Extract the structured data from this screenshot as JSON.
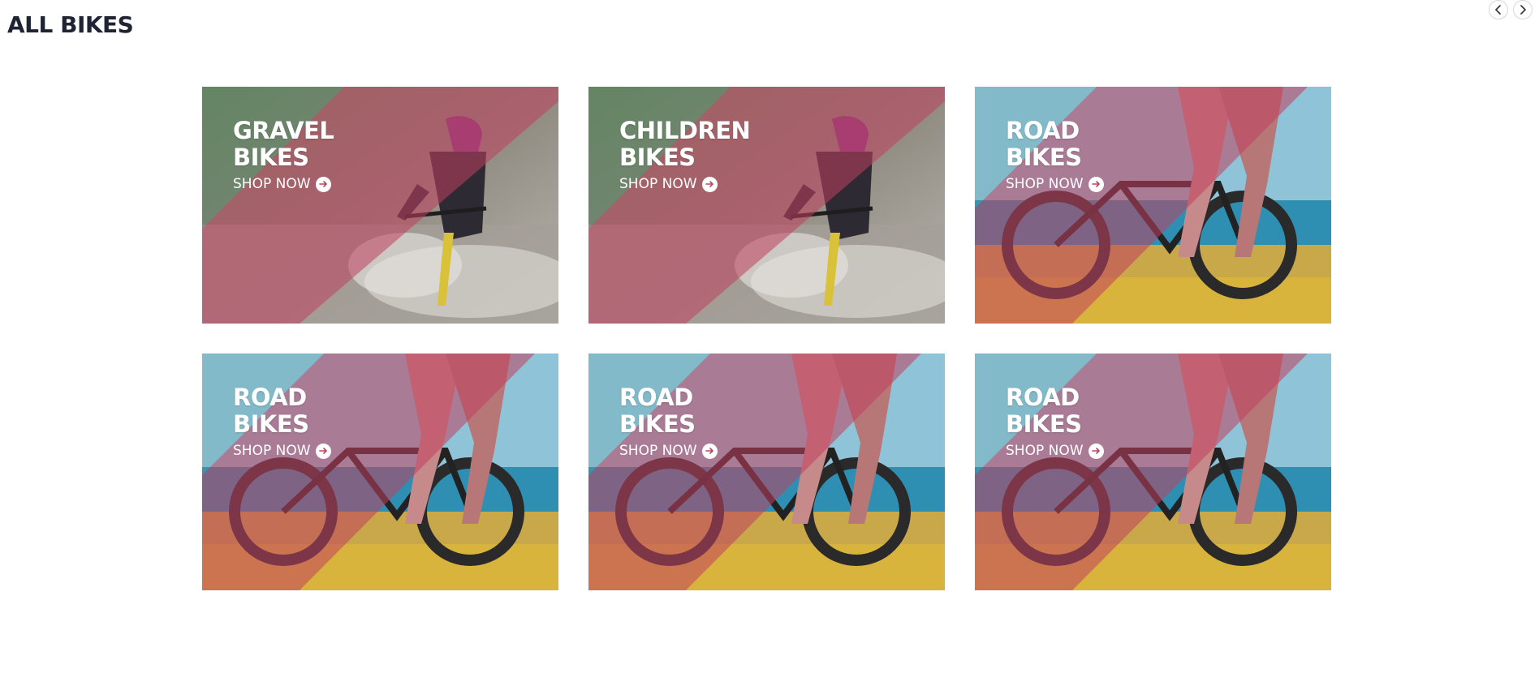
{
  "section": {
    "title": "ALL BIKES"
  },
  "nav": {
    "prev_icon": "chevron-left-icon",
    "next_icon": "chevron-right-icon"
  },
  "colors": {
    "title_text": "#1f2435",
    "overlay_red": "#c0405e",
    "card_text": "#ffffff"
  },
  "cards": [
    {
      "title_line1": "GRAVEL",
      "title_line2": "BIKES",
      "cta": "SHOP NOW",
      "image": "gravel-cyclist-splash",
      "cta_icon": "arrow-right-circle-icon"
    },
    {
      "title_line1": "CHILDREN",
      "title_line2": "BIKES",
      "cta": "SHOP NOW",
      "image": "gravel-cyclist-splash",
      "cta_icon": "arrow-right-circle-icon"
    },
    {
      "title_line1": "ROAD",
      "title_line2": "BIKES",
      "cta": "SHOP NOW",
      "image": "fat-bike-by-sea",
      "cta_icon": "arrow-right-circle-icon"
    },
    {
      "title_line1": "ROAD",
      "title_line2": "BIKES",
      "cta": "SHOP NOW",
      "image": "fat-bike-by-sea",
      "cta_icon": "arrow-right-circle-icon"
    },
    {
      "title_line1": "ROAD",
      "title_line2": "BIKES",
      "cta": "SHOP NOW",
      "image": "fat-bike-by-sea",
      "cta_icon": "arrow-right-circle-icon"
    },
    {
      "title_line1": "ROAD",
      "title_line2": "BIKES",
      "cta": "SHOP NOW",
      "image": "fat-bike-by-sea",
      "cta_icon": "arrow-right-circle-icon"
    }
  ]
}
